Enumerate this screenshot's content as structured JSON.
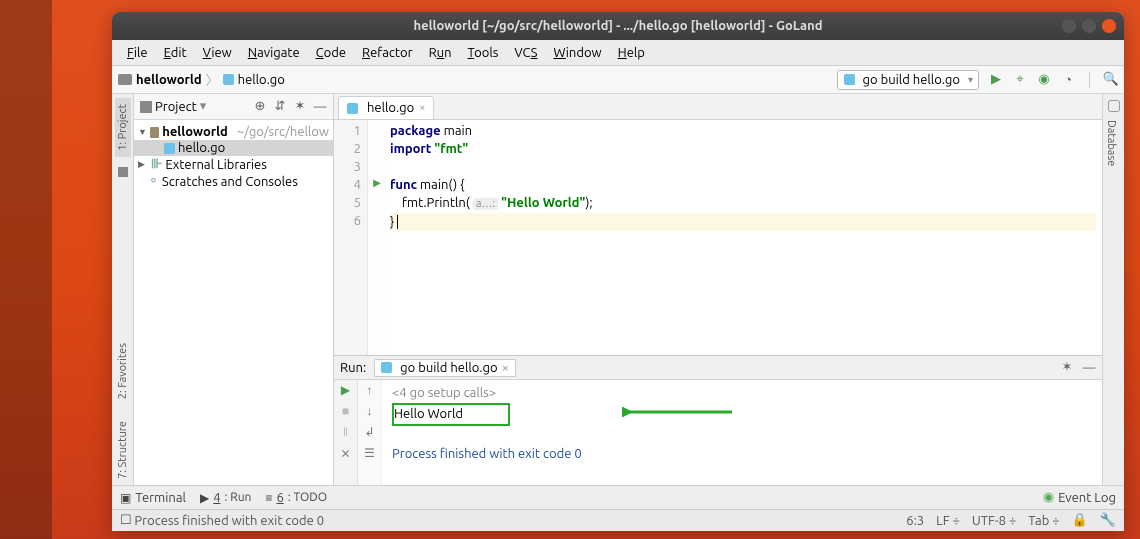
{
  "window_title": "helloworld [~/go/src/helloworld] - .../hello.go [helloworld] - GoLand",
  "menu": [
    "File",
    "Edit",
    "View",
    "Navigate",
    "Code",
    "Refactor",
    "Run",
    "Tools",
    "VCS",
    "Window",
    "Help"
  ],
  "breadcrumb": {
    "project": "helloworld",
    "file": "hello.go"
  },
  "run_config": "go build hello.go",
  "project_panel": {
    "title": "Project",
    "items": [
      {
        "name": "helloworld",
        "hint": "~/go/src/hellow",
        "kind": "root"
      },
      {
        "name": "hello.go",
        "kind": "go",
        "selected": true
      },
      {
        "name": "External Libraries",
        "kind": "lib"
      },
      {
        "name": "Scratches and Consoles",
        "kind": "scratch"
      }
    ]
  },
  "editor_tab": "hello.go",
  "code": {
    "l1a": "package",
    "l1b": " main",
    "l2a": "import",
    "l2b": " ",
    "l2c": "\"fmt\"",
    "l3": "",
    "l4a": "func",
    "l4b": " main() {",
    "l5a": "    fmt.Println( ",
    "l5hint": "a…:",
    "l5b": " ",
    "l5str": "\"Hello World\"",
    "l5c": ");",
    "l6": "} "
  },
  "line_numbers": [
    "1",
    "2",
    "3",
    "4",
    "5",
    "6"
  ],
  "right_tab": "Database",
  "left_tabs": {
    "t1": "1: Project",
    "t2": "2: Favorites",
    "t3": "7: Structure"
  },
  "run_panel": {
    "label": "Run:",
    "tab": "go build hello.go",
    "fold": "<4 go setup calls>",
    "output": "Hello World",
    "finished": "Process finished with exit code 0"
  },
  "bottom_tabs": {
    "terminal": "Terminal",
    "run": "4: Run",
    "todo": "6: TODO",
    "eventlog": "Event Log"
  },
  "status": {
    "msg": "Process finished with exit code 0",
    "pos": "6:3",
    "lf": "LF",
    "enc": "UTF-8",
    "tab": "Tab"
  }
}
